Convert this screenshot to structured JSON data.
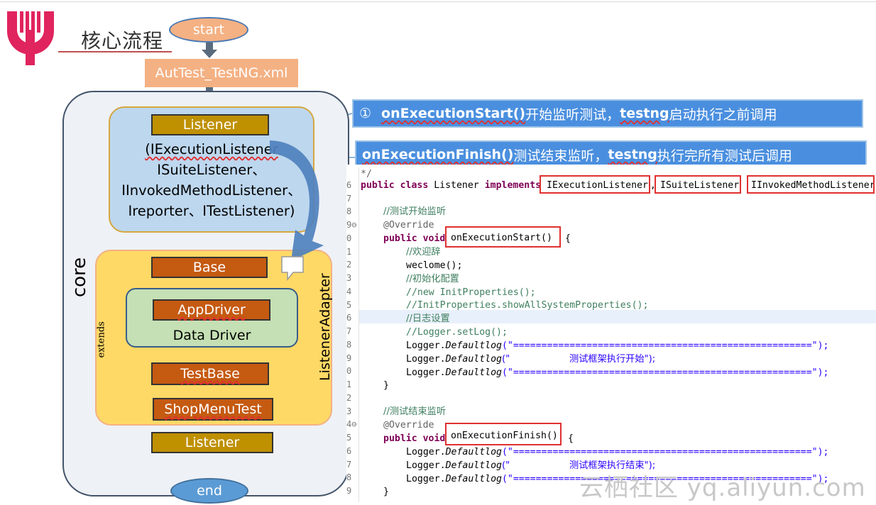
{
  "title": "核心流程",
  "flow": {
    "start": "start",
    "config_file": "AutTest_TestNG.xml",
    "core_label": "core",
    "listener_header": "Listener",
    "listener_interfaces": [
      "(IExecutionListener",
      "ISuiteListener、",
      "IInvokedMethodListener、",
      "Ireporter、ITestListener)"
    ],
    "base": "Base",
    "app_driver": "AppDriver",
    "data_driver": "Data Driver",
    "test_base": "TestBase",
    "shop_menu_test": "ShopMenuTest",
    "listener_bottom": "Listener",
    "end": "end",
    "adapter_label": "ListenerAdapter",
    "extends_label": "extends"
  },
  "callouts": {
    "first_prefix": "①",
    "first_method": "onExecutionStart()",
    "first_text": " 开始监听测试，",
    "first_testng": "testng",
    "first_suffix": "启动执行之前调用",
    "second_method": "onExecutionFinish()",
    "second_text": " 测试结束监听，",
    "second_testng": "testng",
    "second_suffix": "执行完所有测试后调用"
  },
  "code": {
    "line_numbers": [
      "",
      "6",
      "7",
      "8",
      "9⊖",
      "0",
      "1",
      "2",
      "3",
      "4",
      "5",
      "6",
      "7",
      "8",
      "9",
      "0",
      "1",
      "2",
      "3",
      "4⊖",
      "5",
      "6",
      "7",
      "8",
      "9"
    ],
    "top_fragment": "*/",
    "class_public": "public class",
    "class_name": " Listener ",
    "class_implements": "implements",
    "iface1": "IExecutionListener",
    "iface2": "ISuiteListener",
    "iface3": "IInvokedMethodListener",
    "comment_start": "//测试开始监听",
    "override": "@Override",
    "public_void": "public void",
    "method_start": "onExecutionStart()",
    "brace_open": " {",
    "c_welcome": "//欢迎辞",
    "welcome_call": "weclome();",
    "c_init": "//初始化配置",
    "c_new_init": "//new InitProperties();",
    "c_show_props": "//InitProperties.showAllSystemProperties();",
    "c_log_set": "//日志设置",
    "c_setlog": "//Logger.setLog();",
    "logger_prefix": "Logger.",
    "logger_method": "Defaultlog",
    "logger_line_eq": "(\"=====================================================\");",
    "log_start_text": "(\"                    测试框架执行开始\");",
    "log_end_text": "(\"                    测试框架执行结束\");",
    "brace_close": "}",
    "comment_end": "//测试结束监听",
    "method_finish": "onExecutionFinish()",
    "brace_open2": " {"
  },
  "watermark": "云栖社区 yq.aliyun.com"
}
